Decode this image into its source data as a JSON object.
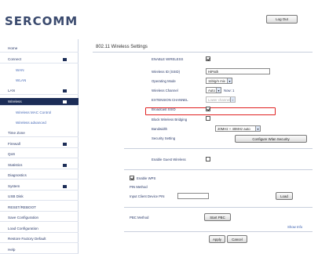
{
  "header": {
    "logo": "SERCOMM",
    "logout_label": "Log Out"
  },
  "sidebar": {
    "items": [
      {
        "label": "Home",
        "type": "item",
        "arrow": false
      },
      {
        "label": "Connect",
        "type": "item",
        "arrow": true
      },
      {
        "label": "WAN",
        "type": "sub"
      },
      {
        "label": "WLAN",
        "type": "sub"
      },
      {
        "label": "LAN",
        "type": "item",
        "arrow": true
      },
      {
        "label": "Wireless",
        "type": "active",
        "arrow": true
      },
      {
        "label": "Wireless MAC Control",
        "type": "sub"
      },
      {
        "label": "Wireless advanced",
        "type": "sub"
      },
      {
        "label": "Time Zone",
        "type": "item",
        "arrow": false
      },
      {
        "label": "Firewall",
        "type": "item",
        "arrow": true
      },
      {
        "label": "QoS",
        "type": "item",
        "arrow": false
      },
      {
        "label": "Statistics",
        "type": "item",
        "arrow": true
      },
      {
        "label": "Diagnostics",
        "type": "item",
        "arrow": false
      },
      {
        "label": "System",
        "type": "item",
        "arrow": true
      },
      {
        "label": "USB Disk",
        "type": "item",
        "arrow": false
      },
      {
        "label": "RESET/REBOOT",
        "type": "item",
        "arrow": false
      },
      {
        "label": "Save Configuration",
        "type": "item",
        "arrow": false
      },
      {
        "label": "Load Configuration",
        "type": "item",
        "arrow": false
      },
      {
        "label": "Restore Factory Default",
        "type": "item",
        "arrow": false
      },
      {
        "label": "Help",
        "type": "item",
        "arrow": false
      }
    ]
  },
  "main": {
    "title": "802.11 Wireless Settings",
    "enable_wireless_label": "ENABLE WIRELESS",
    "ssid_label": "Wireless ID (SSID)",
    "ssid_value": "HiPath",
    "mode_label": "Operating Mode",
    "mode_value": "11b/g/n mix",
    "channel_label": "Wireless Channel",
    "channel_value": "Auto",
    "channel_note": "Now: 1",
    "extension_label": "EXTENSION CHANNEL",
    "extension_value": "Lower channel",
    "broadcast_ssid_label": "Broadcast SSID",
    "block_bridging_label": "Block Wireless Bridging",
    "bandwidth_label": "Bandwidth",
    "bandwidth_value": "20MHz + 40MHz auto",
    "security_label": "Security Setting",
    "configure_security_label": "Configure Wlan Security",
    "guest_label": "Enable Guest Wireless",
    "wps_enable_label": "Enable WPS",
    "pin_method_label": "PIN Method",
    "pin_input_label": "Input Client Device PIN",
    "pin_button_label": "Load",
    "pbc_label": "PBC Method",
    "pbc_button_label": "Start PBC",
    "show_info_label": "Show Info",
    "apply_label": "Apply",
    "cancel_label": "Cancel"
  }
}
